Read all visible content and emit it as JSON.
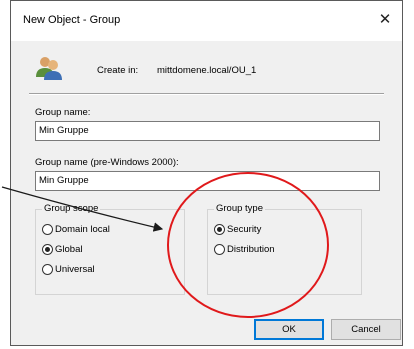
{
  "dialog": {
    "title": "New Object - Group",
    "close_icon": "close-icon",
    "create_in_label": "Create in:",
    "create_in_path": "mittdomene.local/OU_1"
  },
  "fields": {
    "group_name_label": "Group name:",
    "group_name_value": "Min Gruppe",
    "pre2000_label": "Group name (pre-Windows 2000):",
    "pre2000_value": "Min Gruppe"
  },
  "group_scope": {
    "legend": "Group scope",
    "options": [
      {
        "label": "Domain local",
        "selected": false
      },
      {
        "label": "Global",
        "selected": true
      },
      {
        "label": "Universal",
        "selected": false
      }
    ]
  },
  "group_type": {
    "legend": "Group type",
    "options": [
      {
        "label": "Security",
        "selected": true
      },
      {
        "label": "Distribution",
        "selected": false
      }
    ]
  },
  "buttons": {
    "ok": "OK",
    "cancel": "Cancel"
  },
  "annotation": {
    "circle_color": "#e0191b",
    "arrow_color": "#1a1a1a"
  }
}
